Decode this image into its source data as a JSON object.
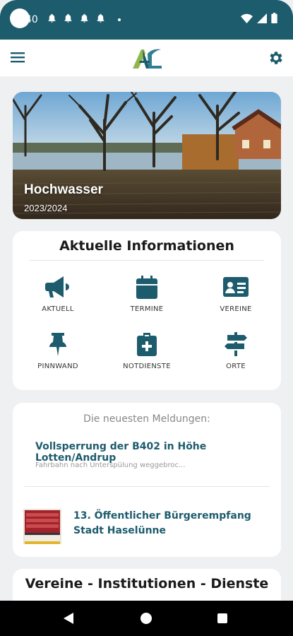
{
  "status_bar": {
    "time": "40",
    "notification_icons": [
      "bell-icon",
      "bell-icon",
      "bell-icon",
      "bell-icon"
    ],
    "system_icons": [
      "wifi-icon",
      "signal-icon",
      "battery-icon"
    ]
  },
  "app_bar": {
    "menu_icon": "menu-icon",
    "logo_text": "AL",
    "settings_icon": "gear-icon"
  },
  "hero": {
    "title": "Hochwasser",
    "subtitle": "2023/2024"
  },
  "info": {
    "title": "Aktuelle Informationen",
    "tiles": [
      {
        "label": "AKTUELL",
        "icon": "megaphone-icon"
      },
      {
        "label": "TERMINE",
        "icon": "calendar-icon"
      },
      {
        "label": "VEREINE",
        "icon": "id-card-icon"
      },
      {
        "label": "PINNWAND",
        "icon": "pushpin-icon"
      },
      {
        "label": "NOTDIENSTE",
        "icon": "medical-kit-icon"
      },
      {
        "label": "ORTE",
        "icon": "signpost-icon"
      }
    ]
  },
  "news": {
    "heading": "Die neuesten Meldungen:",
    "items": [
      {
        "title": "Vollsperrung der B402 in Höhe Lotten/Andrup",
        "excerpt": "Fahrbahn nach Unterspülung weggebroc..."
      },
      {
        "title": "13. Öffentlicher Bürgerempfang Stadt Haselünne"
      }
    ]
  },
  "vereine": {
    "title": "Vereine - Institutionen - Dienste"
  },
  "colors": {
    "primary": "#1d5c6d",
    "background": "#eef0f2",
    "card": "#ffffff"
  }
}
